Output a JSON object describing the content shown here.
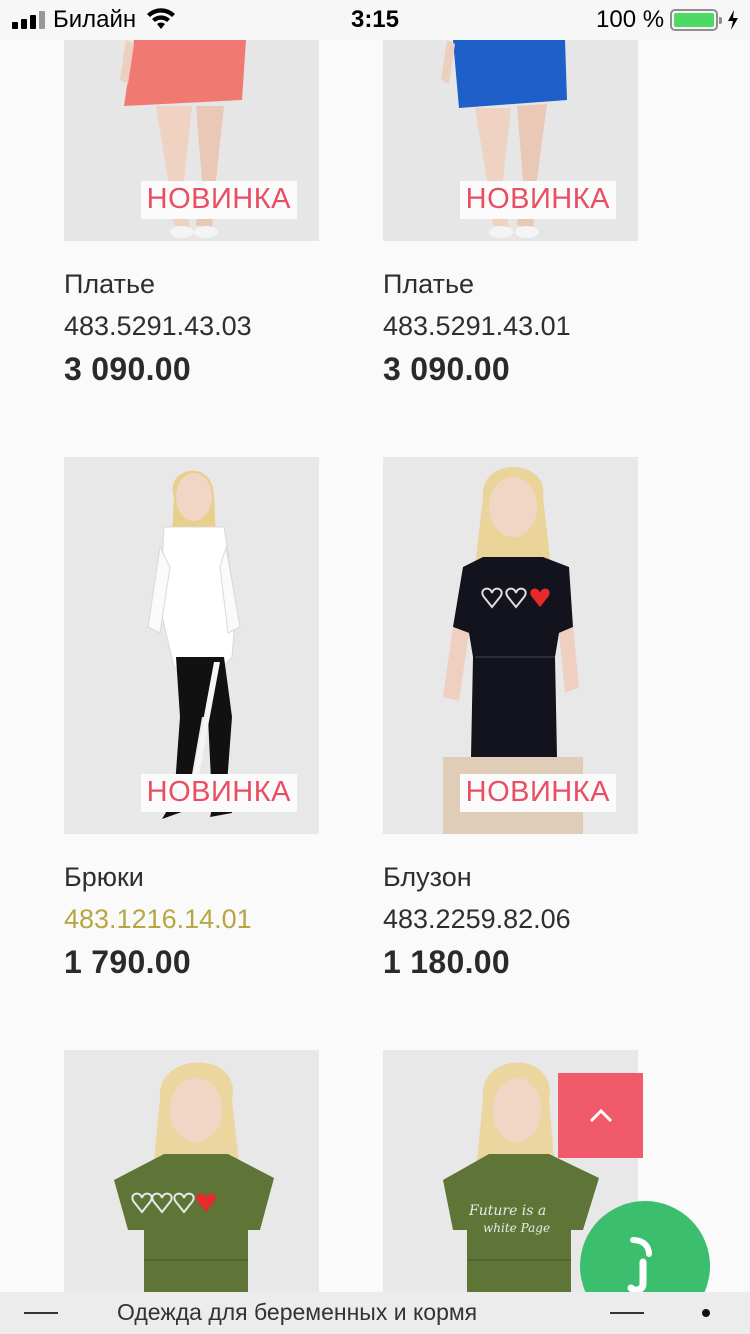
{
  "status_bar": {
    "carrier": "Билайн",
    "time": "3:15",
    "battery_percent": "100 %",
    "battery_level": 1.0,
    "battery_color": "#4cd964"
  },
  "products": [
    {
      "name": "Платье",
      "sku": "483.5291.43.03",
      "price": "3 090.00",
      "badge": "НОВИНКА",
      "dress_color": "#f07a72"
    },
    {
      "name": "Платье",
      "sku": "483.5291.43.01",
      "price": "3 090.00",
      "badge": "НОВИНКА",
      "dress_color": "#1f5fc8"
    },
    {
      "name": "Брюки",
      "sku": "483.1216.14.01",
      "price": "1 790.00",
      "badge": "НОВИНКА",
      "sku_color": "#b8a642"
    },
    {
      "name": "Блузон",
      "sku": "483.2259.82.06",
      "price": "1 180.00",
      "badge": "НОВИНКА"
    },
    {
      "name": "",
      "sku": "",
      "price": ""
    },
    {
      "name": "",
      "sku": "",
      "price": ""
    }
  ],
  "buttons": {
    "scroll_top_icon": "chevron-up-icon",
    "chat_icon": "chat-icon",
    "accent_color": "#f05a6a",
    "chat_color": "#3bbf6e"
  },
  "bottom_bar": {
    "page_title": "Одежда для беременных и кормя"
  }
}
